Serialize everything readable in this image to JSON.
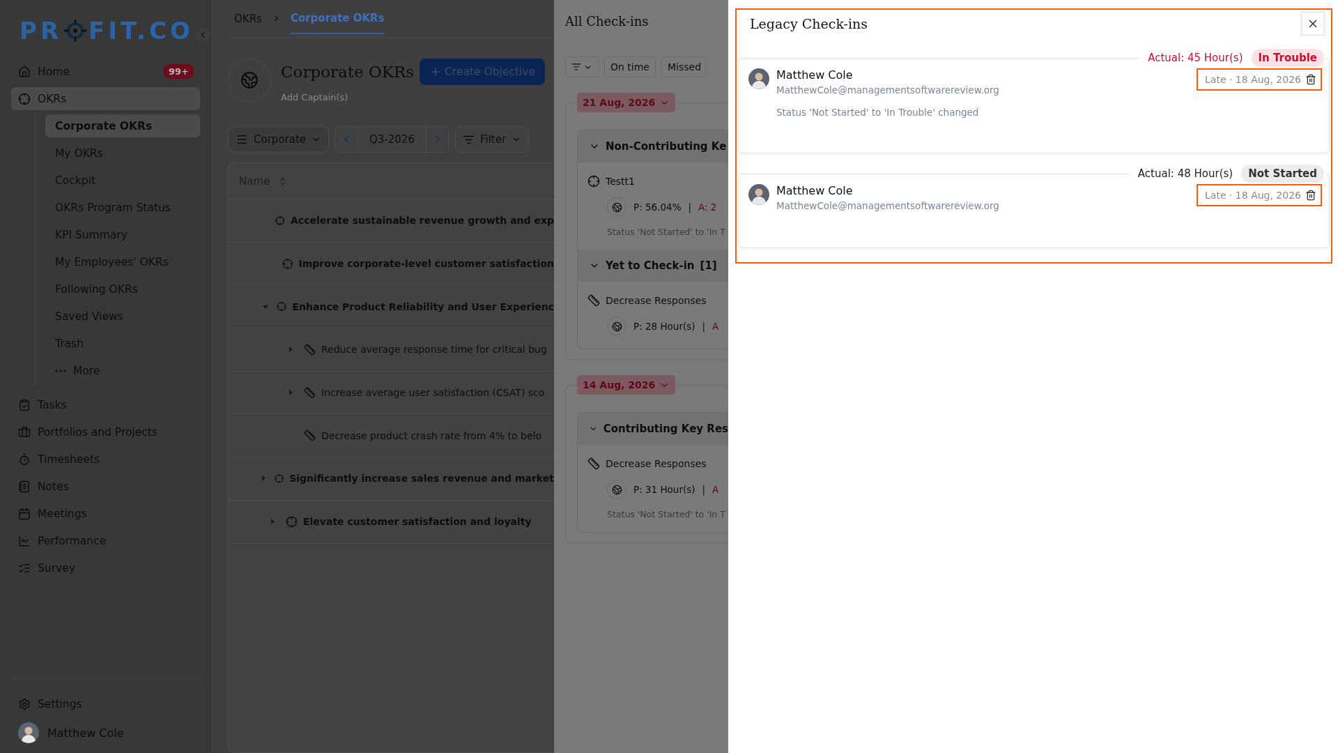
{
  "sidebar": {
    "logo": {
      "before": "PR",
      "after": "FIT.CO"
    },
    "items": [
      {
        "label": "Home",
        "badge": "99+",
        "selected": false
      },
      {
        "label": "OKRs",
        "selected": true,
        "expanded": true,
        "children": [
          {
            "label": "Corporate OKRs",
            "selected": true
          },
          {
            "label": "My OKRs",
            "selected": false
          },
          {
            "label": "Cockpit",
            "selected": false
          },
          {
            "label": "OKRs Program Status",
            "selected": false
          },
          {
            "label": "KPI Summary",
            "selected": false
          },
          {
            "label": "My Employees' OKRs",
            "selected": false
          },
          {
            "label": "Following OKRs",
            "selected": false
          },
          {
            "label": "Saved Views",
            "selected": false
          },
          {
            "label": "Trash",
            "selected": false
          },
          {
            "label": "More",
            "selected": false
          }
        ]
      },
      {
        "label": "Tasks",
        "selected": false
      },
      {
        "label": "Portfolios and Projects",
        "selected": false
      },
      {
        "label": "Timesheets",
        "selected": false
      },
      {
        "label": "Notes",
        "selected": false
      },
      {
        "label": "Meetings",
        "selected": false
      },
      {
        "label": "Performance",
        "selected": false
      },
      {
        "label": "Survey",
        "selected": false
      }
    ],
    "settings": "Settings",
    "user": "Matthew Cole"
  },
  "main": {
    "breadcrumb": [
      {
        "label": "OKRs",
        "selected": false
      },
      {
        "label": "Corporate OKRs",
        "selected": true
      }
    ],
    "title": "Corporate OKRs",
    "create_button": "Create Objective",
    "captain": "Add Captain(s)",
    "toolbar": {
      "view": "Corporate",
      "period": "Q3-2026",
      "filter": "Filter"
    },
    "table": {
      "column": "Name",
      "rows": [
        {
          "kind": "objective",
          "name": "Accelerate sustainable revenue growth and exp",
          "has_children": false
        },
        {
          "kind": "objective",
          "name": "Improve corporate-level customer satisfaction",
          "has_children": false
        },
        {
          "kind": "objective",
          "name": "Enhance Product Reliability and User Experienc",
          "has_children": true,
          "expanded": true,
          "children": [
            {
              "kind": "key_result",
              "name": "Reduce average response time for critical bug",
              "has_children": true,
              "expanded": false
            },
            {
              "kind": "key_result",
              "name": "Increase average user satisfaction (CSAT) sco",
              "has_children": true,
              "expanded": false
            },
            {
              "kind": "key_result",
              "name": "Decrease product crash rate from 4% to belo",
              "has_children": false
            }
          ]
        },
        {
          "kind": "objective",
          "name": "Significantly increase sales revenue and market",
          "has_children": true,
          "expanded": false
        },
        {
          "kind": "objective",
          "name": "Elevate customer satisfaction and loyalty",
          "has_children": true,
          "expanded": false
        }
      ]
    }
  },
  "checkins": {
    "title": "All Check-ins",
    "filters": [
      "On time",
      "Missed"
    ],
    "groups": [
      {
        "date": "21 Aug, 2026",
        "sections": [
          {
            "title": "Non-Contributing Ke",
            "items": [
              {
                "kind": "objective",
                "name": "Testt1",
                "planned": "P: 56.04%",
                "separator": "|",
                "actual": "A: 2",
                "status": "Status 'Not Started' to 'In T"
              }
            ]
          },
          {
            "title": "Yet to Check-in",
            "count": "[1]",
            "items": [
              {
                "kind": "key_result",
                "name": "Decrease Responses",
                "planned": "P: 28 Hour(s)",
                "separator": "|",
                "actual": "A"
              }
            ]
          }
        ]
      },
      {
        "date": "14 Aug, 2026",
        "sections": [
          {
            "title": "Contributing Key Res",
            "items": [
              {
                "kind": "key_result",
                "name": "Decrease Responses",
                "planned": "P: 31 Hour(s)",
                "separator": "|",
                "actual": "A",
                "status": "Status 'Not Started' to 'In T"
              }
            ]
          }
        ]
      }
    ]
  },
  "legacy": {
    "title": "Legacy Check-ins",
    "entries": [
      {
        "actual": "Actual: 45 Hour(s)",
        "status": "In Trouble",
        "kind": "trouble",
        "name": "Matthew Cole",
        "email": "MatthewCole@managementsoftwarereview.org",
        "date": "Late · 18 Aug, 2026",
        "note": "Status 'Not Started' to 'In Trouble' changed"
      },
      {
        "actual": "Actual: 48 Hour(s)",
        "status": "Not Started",
        "kind": "neutral",
        "name": "Matthew Cole",
        "email": "MatthewCole@managementsoftwarereview.org",
        "date": "Late · 18 Aug, 2026"
      }
    ]
  }
}
